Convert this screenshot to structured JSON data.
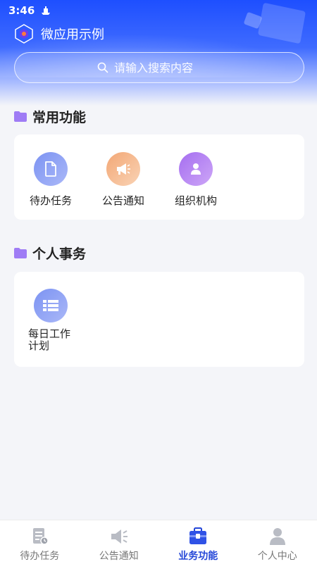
{
  "status_bar": {
    "time": "3:46"
  },
  "header": {
    "title": "微应用示例"
  },
  "search": {
    "placeholder": "请输入搜索内容"
  },
  "sections": [
    {
      "title": "常用功能",
      "items": [
        {
          "label": "待办任务",
          "icon": "document-icon"
        },
        {
          "label": "公告通知",
          "icon": "megaphone-icon"
        },
        {
          "label": "组织机构",
          "icon": "person-icon"
        }
      ]
    },
    {
      "title": "个人事务",
      "items": [
        {
          "label": "每日工作计划",
          "icon": "list-icon"
        }
      ]
    }
  ],
  "tabbar": {
    "active": 2,
    "items": [
      {
        "label": "待办任务",
        "icon": "todo-icon"
      },
      {
        "label": "公告通知",
        "icon": "speaker-icon"
      },
      {
        "label": "业务功能",
        "icon": "briefcase-icon"
      },
      {
        "label": "个人中心",
        "icon": "user-icon"
      }
    ]
  },
  "colors": {
    "primary": "#2446d8",
    "header": "#1e4fff",
    "todo_icon_bg": "#8fa4f5",
    "notice_icon_bg": "#f6b98f",
    "org_icon_bg": "#b583f2",
    "plan_icon_bg": "#8fa4f5"
  }
}
